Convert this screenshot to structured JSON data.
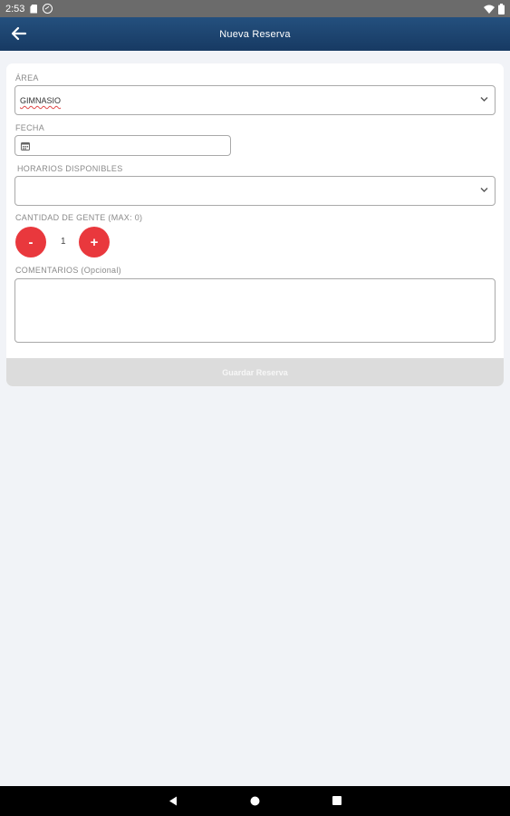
{
  "status_bar": {
    "time": "2:53"
  },
  "app_bar": {
    "title": "Nueva Reserva"
  },
  "form": {
    "area_label": "ÁREA",
    "area_value": "GIMNASIO",
    "fecha_label": "FECHA",
    "horarios_label": "HORARIOS DISPONIBLES",
    "horarios_value": "",
    "cantidad_label": "CANTIDAD DE GENTE (MAX: 0)",
    "minus_label": "-",
    "quantity": "1",
    "plus_label": "+",
    "comentarios_label": "COMENTARIOS (Opcional)",
    "comentarios_value": "",
    "save_label": "Guardar Reserva"
  },
  "colors": {
    "app_bar": "#1f4675",
    "accent_red": "#e9383d",
    "background": "#f1f3f7",
    "save_disabled": "#dcdcdc"
  },
  "icons": [
    "sd-card-icon",
    "sync-icon",
    "wifi-icon",
    "battery-icon",
    "back-arrow-icon",
    "chevron-down-icon",
    "calendar-icon",
    "nav-back-icon",
    "nav-home-icon",
    "nav-recents-icon"
  ]
}
